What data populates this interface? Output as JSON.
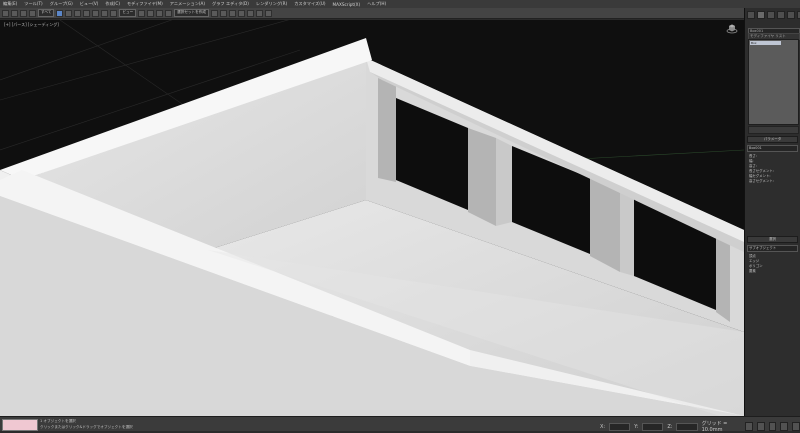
{
  "menu": [
    "編集(E)",
    "ツール(T)",
    "グループ(G)",
    "ビュー(V)",
    "作成(C)",
    "モディファイヤ(M)",
    "アニメーション(A)",
    "グラフ エディタ(D)",
    "レンダリング(R)",
    "カスタマイズ(U)",
    "MAXScript(X)",
    "ヘルプ(H)"
  ],
  "toolbar": {
    "selection_set": "すべて",
    "view_dropdown": "ビュー",
    "named_set": "選択セットを作成"
  },
  "viewport": {
    "label": "[+] [パース] [シェーディング]"
  },
  "command_panel": {
    "object_name": "Box001",
    "modifier_list": "モディファイヤ リスト",
    "selected_modifier": "Box",
    "rollouts": [
      {
        "title": "パラメータ",
        "field": "Box001",
        "items": [
          "長さ:",
          "幅:",
          "高さ:",
          "長さセグメント:",
          "幅セグメント:",
          "高さセグメント:"
        ]
      },
      {
        "title": "選択",
        "field": "サブオブジェクト",
        "items": [
          "頂点",
          "エッジ",
          "ポリゴン",
          "要素"
        ]
      }
    ]
  },
  "statusbar": {
    "line1": "1 オブジェクトを選択",
    "line2": "クリックまたはクリック&ドラッグでオブジェクトを選択",
    "x": "X:",
    "y": "Y:",
    "z": "Z:",
    "grid": "グリッド = 10.0mm"
  },
  "colors": {
    "viewport_bg": "#0f0f0f",
    "panel_bg": "#2d2d2d",
    "accent": "#5b86c8"
  }
}
